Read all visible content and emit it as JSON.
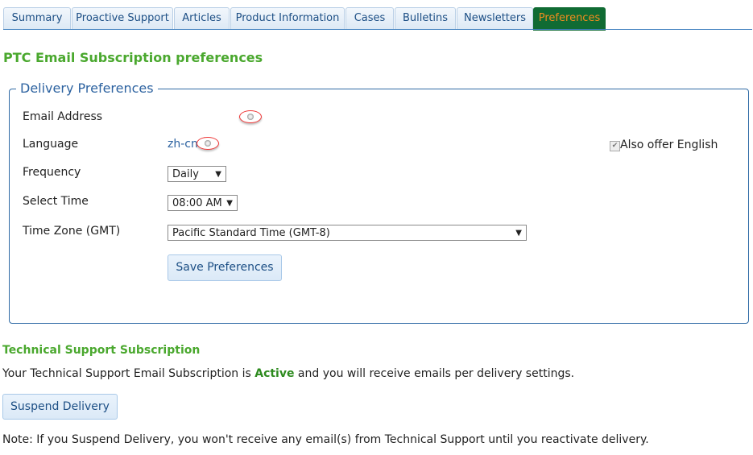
{
  "tabs": [
    {
      "label": "Summary",
      "active": false
    },
    {
      "label": "Proactive Support",
      "active": false
    },
    {
      "label": "Articles",
      "active": false
    },
    {
      "label": "Product Information",
      "active": false
    },
    {
      "label": "Cases",
      "active": false
    },
    {
      "label": "Bulletins",
      "active": false
    },
    {
      "label": "Newsletters",
      "active": false
    },
    {
      "label": "Preferences",
      "active": true
    }
  ],
  "page_title": "PTC Email Subscription preferences",
  "delivery": {
    "legend": "Delivery Preferences",
    "email_label": "Email Address",
    "language_label": "Language",
    "language_value": "zh-cn",
    "frequency_label": "Frequency",
    "frequency_value": "Daily",
    "time_label": "Select Time",
    "time_value": "08:00 AM",
    "timezone_label": "Time Zone (GMT)",
    "timezone_value": "Pacific Standard Time (GMT-8)",
    "also_english_label": "Also offer English",
    "also_english_checked": true,
    "save_button": "Save Preferences"
  },
  "tech_support": {
    "title": "Technical Support Subscription",
    "status_prefix": "Your Technical Support Email Subscription is ",
    "status_word": "Active",
    "status_suffix": " and you will receive emails per delivery settings.",
    "suspend_button": "Suspend Delivery",
    "note": "Note: If you Suspend Delivery, you won't receive any email(s) from Technical Support until you reactivate delivery."
  },
  "colors": {
    "active_tab_bg": "#106b33",
    "active_tab_text": "#f08c1e",
    "title_green": "#4aa82e",
    "link_blue": "#2c62a0"
  },
  "icons": {
    "gear": "gear-icon",
    "arrow": "chevron-down-icon",
    "check": "checkmark-icon"
  }
}
